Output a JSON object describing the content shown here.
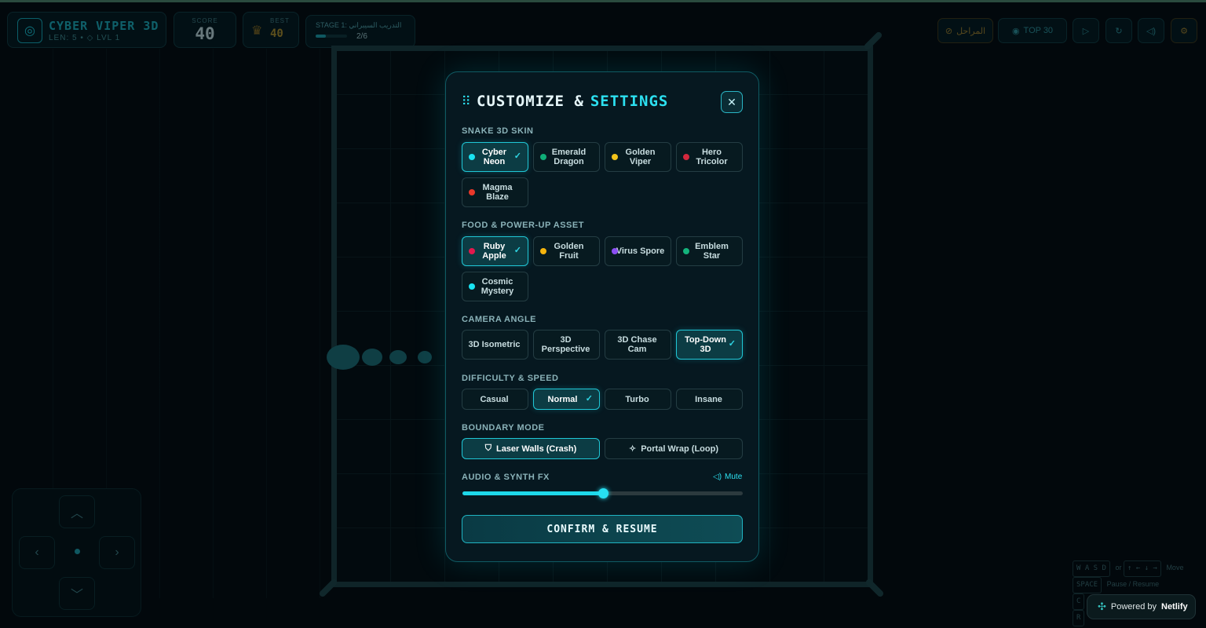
{
  "hud": {
    "title": "CYBER VIPER 3D",
    "len_label": "LEN:",
    "len_value": "5",
    "level_text": "LVL 1",
    "score_label": "SCORE",
    "score_value": "40",
    "best_label": "BEST",
    "best_value": "40",
    "stage_label": "STAGE 1: التدريب السيبراني",
    "stage_progress": "2/6",
    "stage_fraction": 0.33,
    "levels_label": "المراحل",
    "top30_label": "TOP 30"
  },
  "controls_hint": {
    "move_keys": "W A S D",
    "or": "or",
    "arrows": "↑ ← ↓ →",
    "move_label": "Move",
    "space_key": "SPACE",
    "pause_label": "Pause / Resume",
    "c_key": "C",
    "r_key": "R"
  },
  "netlify": {
    "prefix": "Powered by",
    "brand": "Netlify"
  },
  "modal": {
    "title_a": "CUSTOMIZE &",
    "title_b": "SETTINGS",
    "skin_title": "SNAKE 3D SKIN",
    "skins": [
      {
        "label": "Cyber Neon",
        "color": "#19e3f2",
        "selected": true
      },
      {
        "label": "Emerald Dragon",
        "color": "#0fae78",
        "selected": false
      },
      {
        "label": "Golden Viper",
        "color": "#f2c31a",
        "selected": false
      },
      {
        "label": "Hero Tricolor",
        "color": "#d3283d",
        "selected": false
      },
      {
        "label": "Magma Blaze",
        "color": "#e9382a",
        "selected": false
      }
    ],
    "food_title": "FOOD & POWER-UP ASSET",
    "foods": [
      {
        "label": "Ruby Apple",
        "color": "#e3184d",
        "selected": true
      },
      {
        "label": "Golden Fruit",
        "color": "#f5b40d",
        "selected": false
      },
      {
        "label": "Virus Spore",
        "color": "#8b4ef2",
        "selected": false
      },
      {
        "label": "Emblem Star",
        "color": "#14b37c",
        "selected": false
      },
      {
        "label": "Cosmic Mystery",
        "color": "#19e3f2",
        "selected": false
      }
    ],
    "camera_title": "CAMERA ANGLE",
    "cameras": [
      {
        "label": "3D Isometric",
        "selected": false
      },
      {
        "label": "3D Perspective",
        "selected": false
      },
      {
        "label": "3D Chase Cam",
        "selected": false
      },
      {
        "label": "Top-Down 3D",
        "selected": true
      }
    ],
    "difficulty_title": "DIFFICULTY & SPEED",
    "difficulties": [
      {
        "label": "Casual",
        "selected": false
      },
      {
        "label": "Normal",
        "selected": true
      },
      {
        "label": "Turbo",
        "selected": false
      },
      {
        "label": "Insane",
        "selected": false
      }
    ],
    "boundary_title": "BOUNDARY MODE",
    "boundary_walls": "Laser Walls (Crash)",
    "boundary_portal": "Portal Wrap (Loop)",
    "audio_title": "AUDIO & SYNTH FX",
    "mute_label": "Mute",
    "volume": 0.5,
    "confirm_label": "CONFIRM & RESUME"
  }
}
